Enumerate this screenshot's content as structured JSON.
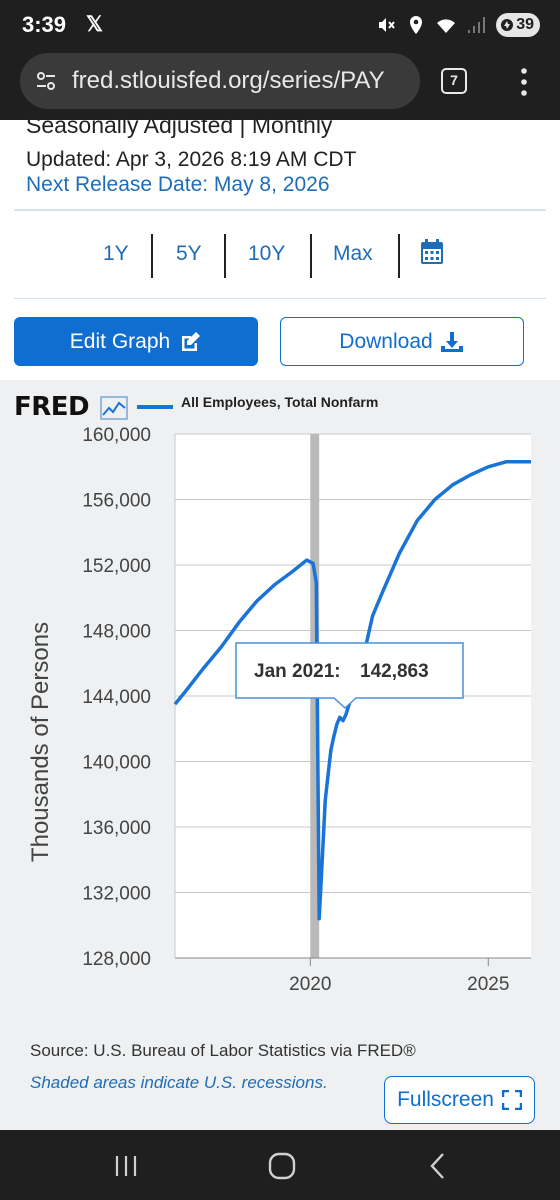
{
  "status": {
    "time": "3:39",
    "notification": "𝕏",
    "battery": "39",
    "icons": [
      "mute-icon",
      "location-icon",
      "wifi-6-icon",
      "signal-icon",
      "battery-icon"
    ]
  },
  "browser": {
    "url": "fred.stlouisfed.org/series/PAY",
    "tab_count": "7",
    "icons": [
      "site-settings-icon",
      "tabs-icon",
      "more-options-icon"
    ]
  },
  "page": {
    "seasonal_text": "Seasonally Adjusted | Monthly",
    "updated": "Updated: Apr 3, 2026 8:19 AM CDT",
    "next_release": "Next Release Date: May 8, 2026",
    "ranges": [
      "1Y",
      "5Y",
      "10Y",
      "Max"
    ],
    "edit_graph": "Edit Graph",
    "download": "Download",
    "source": "Source: U.S. Bureau of Labor Statistics via FRED®",
    "shaded": "Shaded areas indicate U.S. recessions.",
    "fullscreen": "Fullscreen"
  },
  "chart": {
    "logo": "FRED",
    "series_label": "All Employees, Total Nonfarm",
    "tooltip_date": "Jan 2021:",
    "tooltip_value": "142,863",
    "accent": "#1a73d6"
  },
  "chart_data": {
    "type": "line",
    "title": "",
    "xlabel": "",
    "ylabel": "Thousands of Persons",
    "ylim": [
      128000,
      160000
    ],
    "y_ticks": [
      "160,000",
      "156,000",
      "152,000",
      "148,000",
      "144,000",
      "140,000",
      "136,000",
      "132,000",
      "128,000"
    ],
    "x_ticks": [
      "2020",
      "2025"
    ],
    "x_range": [
      2016.2,
      2026.2
    ],
    "recession": [
      2020.0,
      2020.25
    ],
    "series": [
      {
        "name": "All Employees, Total Nonfarm",
        "x": [
          2016.2,
          2016.5,
          2017.0,
          2017.5,
          2018.0,
          2018.5,
          2019.0,
          2019.5,
          2019.9,
          2020.08,
          2020.17,
          2020.25,
          2020.33,
          2020.42,
          2020.5,
          2020.58,
          2020.67,
          2020.75,
          2020.83,
          2020.92,
          2021.0,
          2021.25,
          2021.5,
          2021.75,
          2022.0,
          2022.5,
          2023.0,
          2023.5,
          2024.0,
          2024.5,
          2025.0,
          2025.5,
          2026.0,
          2026.2
        ],
        "values": [
          143500,
          144300,
          145700,
          147000,
          148500,
          149800,
          150800,
          151600,
          152300,
          152100,
          150900,
          130400,
          133700,
          137600,
          139200,
          140700,
          141600,
          142300,
          142700,
          142500,
          142863,
          144600,
          146500,
          148900,
          150200,
          152700,
          154700,
          156000,
          156900,
          157500,
          158000,
          158300,
          158300,
          158300
        ]
      }
    ],
    "grid": true
  }
}
